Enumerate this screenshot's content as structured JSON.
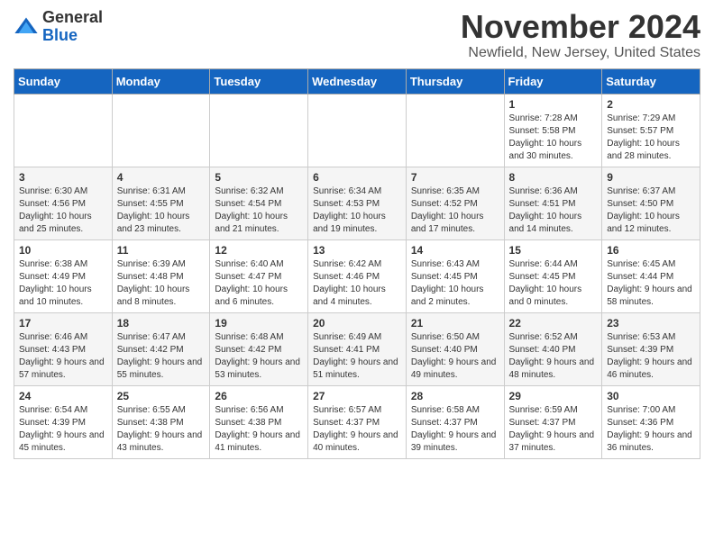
{
  "header": {
    "logo": {
      "text_general": "General",
      "text_blue": "Blue"
    },
    "title": "November 2024",
    "location": "Newfield, New Jersey, United States"
  },
  "days_of_week": [
    "Sunday",
    "Monday",
    "Tuesday",
    "Wednesday",
    "Thursday",
    "Friday",
    "Saturday"
  ],
  "weeks": [
    {
      "days": [
        {
          "num": "",
          "info": ""
        },
        {
          "num": "",
          "info": ""
        },
        {
          "num": "",
          "info": ""
        },
        {
          "num": "",
          "info": ""
        },
        {
          "num": "",
          "info": ""
        },
        {
          "num": "1",
          "info": "Sunrise: 7:28 AM\nSunset: 5:58 PM\nDaylight: 10 hours and 30 minutes."
        },
        {
          "num": "2",
          "info": "Sunrise: 7:29 AM\nSunset: 5:57 PM\nDaylight: 10 hours and 28 minutes."
        }
      ]
    },
    {
      "days": [
        {
          "num": "3",
          "info": "Sunrise: 6:30 AM\nSunset: 4:56 PM\nDaylight: 10 hours and 25 minutes."
        },
        {
          "num": "4",
          "info": "Sunrise: 6:31 AM\nSunset: 4:55 PM\nDaylight: 10 hours and 23 minutes."
        },
        {
          "num": "5",
          "info": "Sunrise: 6:32 AM\nSunset: 4:54 PM\nDaylight: 10 hours and 21 minutes."
        },
        {
          "num": "6",
          "info": "Sunrise: 6:34 AM\nSunset: 4:53 PM\nDaylight: 10 hours and 19 minutes."
        },
        {
          "num": "7",
          "info": "Sunrise: 6:35 AM\nSunset: 4:52 PM\nDaylight: 10 hours and 17 minutes."
        },
        {
          "num": "8",
          "info": "Sunrise: 6:36 AM\nSunset: 4:51 PM\nDaylight: 10 hours and 14 minutes."
        },
        {
          "num": "9",
          "info": "Sunrise: 6:37 AM\nSunset: 4:50 PM\nDaylight: 10 hours and 12 minutes."
        }
      ]
    },
    {
      "days": [
        {
          "num": "10",
          "info": "Sunrise: 6:38 AM\nSunset: 4:49 PM\nDaylight: 10 hours and 10 minutes."
        },
        {
          "num": "11",
          "info": "Sunrise: 6:39 AM\nSunset: 4:48 PM\nDaylight: 10 hours and 8 minutes."
        },
        {
          "num": "12",
          "info": "Sunrise: 6:40 AM\nSunset: 4:47 PM\nDaylight: 10 hours and 6 minutes."
        },
        {
          "num": "13",
          "info": "Sunrise: 6:42 AM\nSunset: 4:46 PM\nDaylight: 10 hours and 4 minutes."
        },
        {
          "num": "14",
          "info": "Sunrise: 6:43 AM\nSunset: 4:45 PM\nDaylight: 10 hours and 2 minutes."
        },
        {
          "num": "15",
          "info": "Sunrise: 6:44 AM\nSunset: 4:45 PM\nDaylight: 10 hours and 0 minutes."
        },
        {
          "num": "16",
          "info": "Sunrise: 6:45 AM\nSunset: 4:44 PM\nDaylight: 9 hours and 58 minutes."
        }
      ]
    },
    {
      "days": [
        {
          "num": "17",
          "info": "Sunrise: 6:46 AM\nSunset: 4:43 PM\nDaylight: 9 hours and 57 minutes."
        },
        {
          "num": "18",
          "info": "Sunrise: 6:47 AM\nSunset: 4:42 PM\nDaylight: 9 hours and 55 minutes."
        },
        {
          "num": "19",
          "info": "Sunrise: 6:48 AM\nSunset: 4:42 PM\nDaylight: 9 hours and 53 minutes."
        },
        {
          "num": "20",
          "info": "Sunrise: 6:49 AM\nSunset: 4:41 PM\nDaylight: 9 hours and 51 minutes."
        },
        {
          "num": "21",
          "info": "Sunrise: 6:50 AM\nSunset: 4:40 PM\nDaylight: 9 hours and 49 minutes."
        },
        {
          "num": "22",
          "info": "Sunrise: 6:52 AM\nSunset: 4:40 PM\nDaylight: 9 hours and 48 minutes."
        },
        {
          "num": "23",
          "info": "Sunrise: 6:53 AM\nSunset: 4:39 PM\nDaylight: 9 hours and 46 minutes."
        }
      ]
    },
    {
      "days": [
        {
          "num": "24",
          "info": "Sunrise: 6:54 AM\nSunset: 4:39 PM\nDaylight: 9 hours and 45 minutes."
        },
        {
          "num": "25",
          "info": "Sunrise: 6:55 AM\nSunset: 4:38 PM\nDaylight: 9 hours and 43 minutes."
        },
        {
          "num": "26",
          "info": "Sunrise: 6:56 AM\nSunset: 4:38 PM\nDaylight: 9 hours and 41 minutes."
        },
        {
          "num": "27",
          "info": "Sunrise: 6:57 AM\nSunset: 4:37 PM\nDaylight: 9 hours and 40 minutes."
        },
        {
          "num": "28",
          "info": "Sunrise: 6:58 AM\nSunset: 4:37 PM\nDaylight: 9 hours and 39 minutes."
        },
        {
          "num": "29",
          "info": "Sunrise: 6:59 AM\nSunset: 4:37 PM\nDaylight: 9 hours and 37 minutes."
        },
        {
          "num": "30",
          "info": "Sunrise: 7:00 AM\nSunset: 4:36 PM\nDaylight: 9 hours and 36 minutes."
        }
      ]
    }
  ]
}
